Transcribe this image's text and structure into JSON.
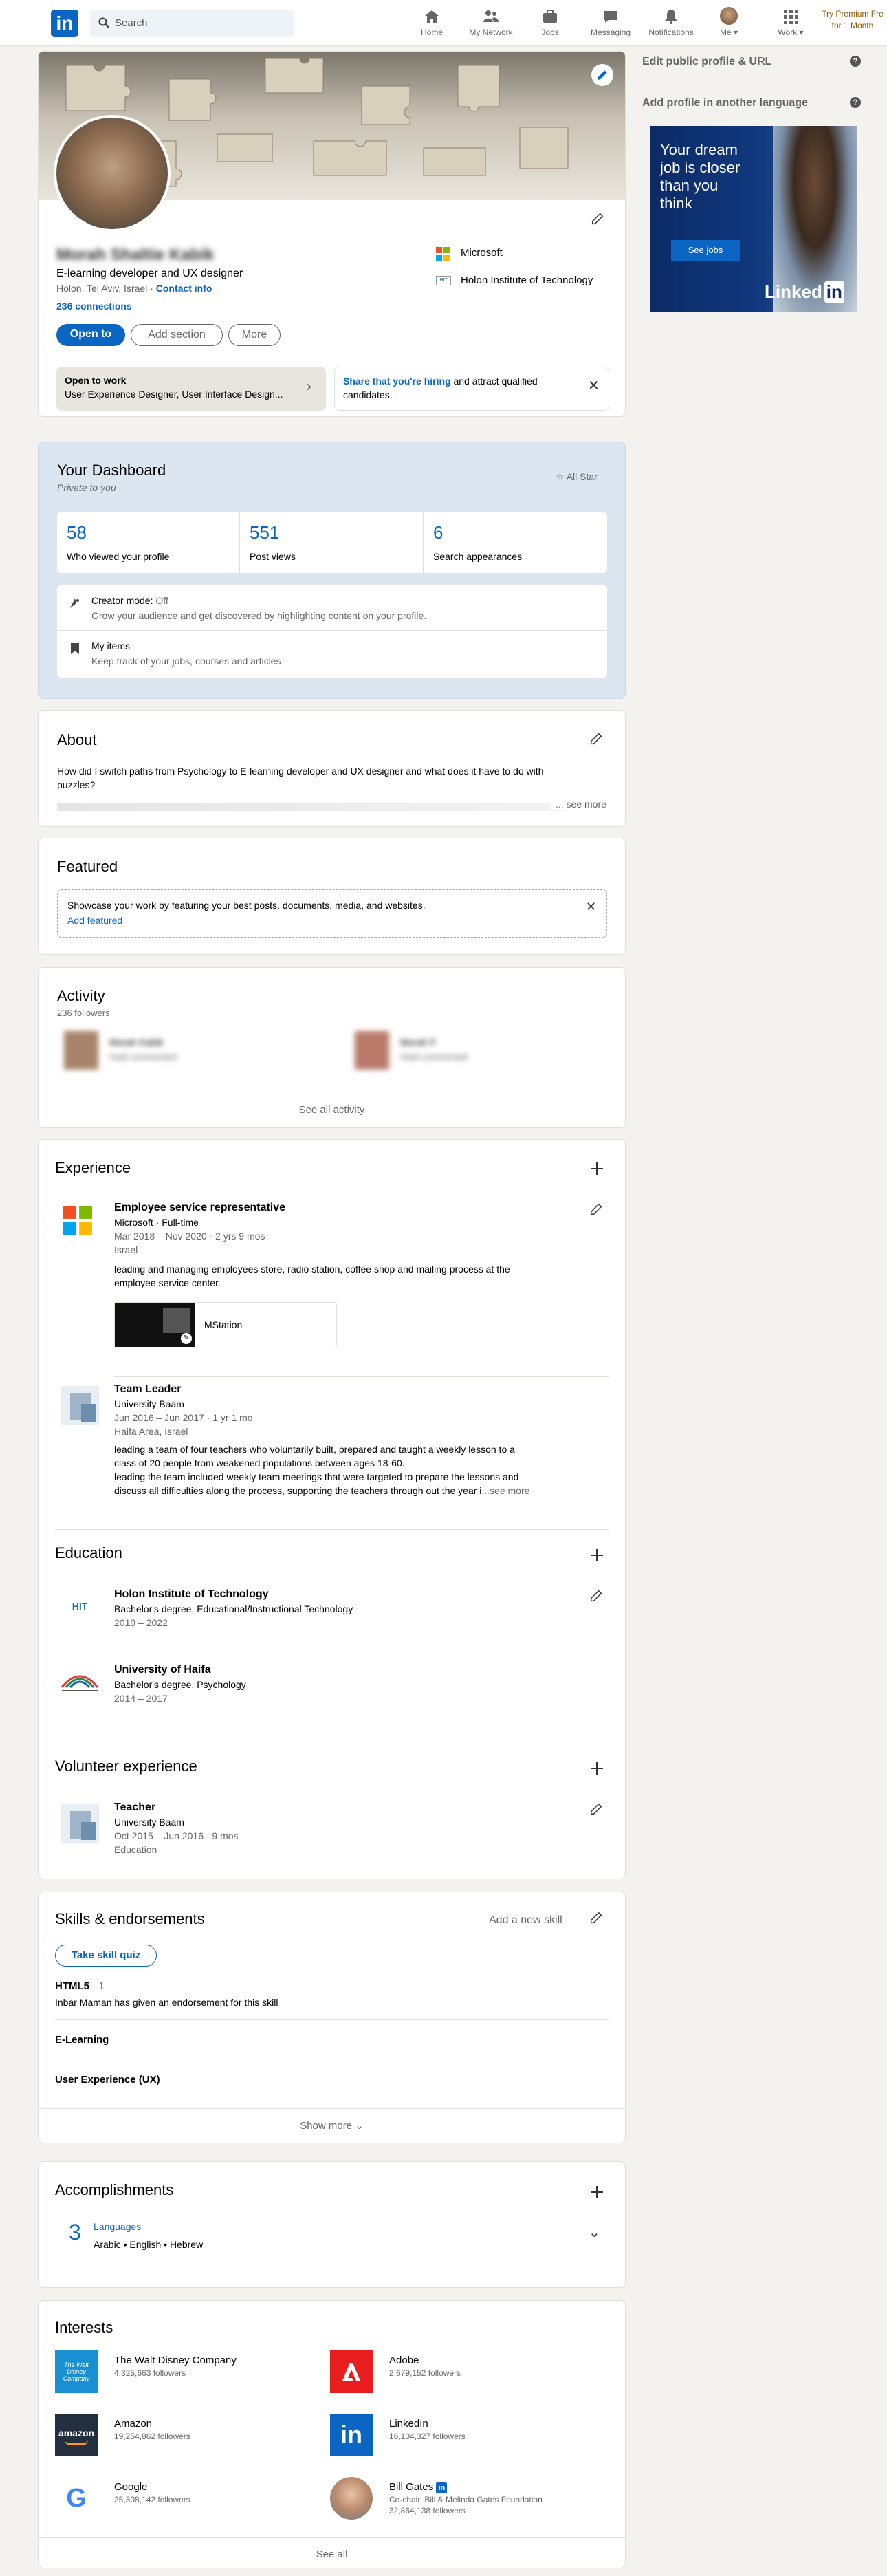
{
  "nav": {
    "search_placeholder": "Search",
    "items": [
      "Home",
      "My Network",
      "Jobs",
      "Messaging",
      "Notifications",
      "Me",
      "Work"
    ],
    "premium_line1": "Try Premium Fre",
    "premium_line2": "for 1 Month"
  },
  "profile": {
    "name": "Morah Shaltie Kabik",
    "headline": "E-learning developer and UX designer",
    "location": "Holon, Tel Aviv, Israel",
    "contact": "Contact info",
    "connections": "236 connections",
    "company": "Microsoft",
    "school": "Holon Institute of Technology",
    "btn_open": "Open to",
    "btn_add": "Add section",
    "btn_more": "More",
    "open_title": "Open to work",
    "open_text": "User Experience Designer, User Interface Design...",
    "hiring_link": "Share that you're hiring",
    "hiring_text": " and attract qualified",
    "hiring_text2": "candidates."
  },
  "dashboard": {
    "title": "Your Dashboard",
    "subtitle": "Private to you",
    "star": "All Star",
    "stats": [
      {
        "value": "58",
        "label": "Who viewed your profile"
      },
      {
        "value": "551",
        "label": "Post views"
      },
      {
        "value": "6",
        "label": "Search appearances"
      }
    ],
    "creator_title": "Creator mode:",
    "creator_state": "Off",
    "creator_text": "Grow your audience and get discovered by highlighting content on your profile.",
    "items_title": "My items",
    "items_text": "Keep track of your jobs, courses and articles"
  },
  "about": {
    "title": "About",
    "text1": "How did I switch paths from Psychology to E-learning developer and UX designer and what does it have to do with",
    "text2": "puzzles?",
    "see_more": "... see more"
  },
  "featured": {
    "title": "Featured",
    "text": "Showcase your work by featuring your best posts, documents, media, and websites.",
    "link": "Add featured"
  },
  "activity": {
    "title": "Activity",
    "followers": "236 followers",
    "see_all": "See all activity",
    "items": [
      {
        "name": "Morah Kabik",
        "desc": "Hadi commented"
      },
      {
        "name": "Morah F",
        "desc": "Hadi commented"
      }
    ]
  },
  "experience": {
    "title": "Experience",
    "jobs": [
      {
        "title": "Employee service representative",
        "company": "Microsoft · Full-time",
        "dates": "Mar 2018 – Nov 2020 · 2 yrs 9 mos",
        "location": "Israel",
        "desc1": "leading and managing employees store, radio station, coffee shop and mailing process at the",
        "desc2": "employee service center.",
        "media": "MStation"
      },
      {
        "title": "Team Leader",
        "company": "University Baam",
        "dates": "Jun 2016 – Jun 2017 · 1 yr 1 mo",
        "location": "Haifa Area, Israel",
        "desc1": "leading a team of four teachers who voluntarily built, prepared and taught a weekly lesson to a",
        "desc2": "class of 20 people from weakened populations between ages 18-60.",
        "desc3": "leading the team included weekly team meetings that were targeted to prepare the lessons and",
        "desc4": "discuss all difficulties along the process, supporting the teachers through out the year i",
        "see_more": "...see more"
      }
    ]
  },
  "education": {
    "title": "Education",
    "schools": [
      {
        "name": "Holon Institute of Technology",
        "degree": "Bachelor's degree, Educational/Instructional Technology",
        "dates": "2019 – 2022",
        "logo": "HIT"
      },
      {
        "name": "University of Haifa",
        "degree": "Bachelor's degree, Psychology",
        "dates": "2014 – 2017"
      }
    ]
  },
  "volunteer": {
    "title": "Volunteer experience",
    "role": "Teacher",
    "org": "University Baam",
    "dates": "Oct 2015 – Jun 2016 · 9 mos",
    "cause": "Education"
  },
  "skills": {
    "title": "Skills & endorsements",
    "add": "Add a new skill",
    "quiz": "Take skill quiz",
    "list": [
      {
        "name": "HTML5",
        "count": " · 1",
        "endorse": "Inbar Maman has given an endorsement for this skill"
      },
      {
        "name": "E-Learning"
      },
      {
        "name": "User Experience (UX)"
      }
    ],
    "show_more": "Show more"
  },
  "accomplishments": {
    "title": "Accomplishments",
    "count": "3",
    "label": "Languages",
    "items": "Arabic • English • Hebrew"
  },
  "interests": {
    "title": "Interests",
    "items": [
      {
        "name": "The Walt Disney Company",
        "meta": "4,325,663 followers",
        "logo_text": "The Walt Disney Company"
      },
      {
        "name": "Adobe",
        "meta": "2,679,152 followers"
      },
      {
        "name": "Amazon",
        "meta": "19,254,862 followers",
        "logo_text": "amazon"
      },
      {
        "name": "LinkedIn",
        "meta": "16,104,327 followers",
        "logo_text": "in"
      },
      {
        "name": "Google",
        "meta": "25,308,142 followers",
        "logo_text": "G"
      },
      {
        "name": "Bill Gates",
        "meta": "Co-chair, Bill & Melinda Gates Foundation",
        "meta2": "32,864,138 followers"
      }
    ],
    "see_all": "See all"
  },
  "sidebar": {
    "edit_url": "Edit public profile & URL",
    "add_lang": "Add profile in another language",
    "ad_line1": "Your dream",
    "ad_line2": "job is closer",
    "ad_line3": "than you",
    "ad_line4": "think",
    "ad_button": "See jobs",
    "ad_brand": "Linked",
    "ad_brand_in": "in"
  },
  "colors": {
    "accent": "#0a66c2",
    "background": "#f3f2ef",
    "dashboard_bg": "#dce6f1",
    "ad_bg": "#0b2a66"
  }
}
